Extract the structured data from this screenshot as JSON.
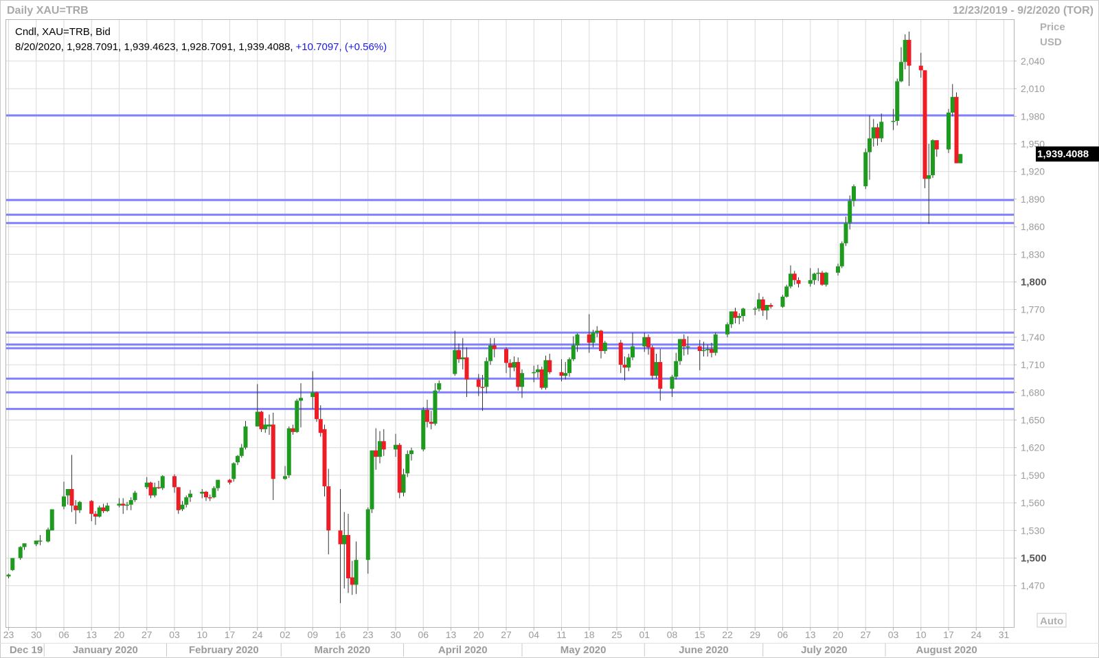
{
  "header": {
    "left_title": "Daily XAU=TRB",
    "right_range": "12/23/2019 - 9/2/2020 (TOR)"
  },
  "info": {
    "line1": "Cndl, XAU=TRB, Bid",
    "line2_values": "8/20/2020, 1,928.7091, 1,939.4623, 1,928.7091, 1,939.4088,",
    "line2_change": "+10.7097, (+0.56%)"
  },
  "price_axis": {
    "header_1": "Price",
    "header_2": "USD",
    "auto_label": "Auto",
    "ticks": [
      "2,040",
      "2,010",
      "1,980",
      "1,950",
      "1,920",
      "1,890",
      "1,860",
      "1,830",
      "1,800",
      "1,770",
      "1,740",
      "1,710",
      "1,680",
      "1,650",
      "1,620",
      "1,590",
      "1,560",
      "1,530",
      "1,500",
      "1,470"
    ],
    "bold_ticks": [
      "1,800",
      "1,500"
    ],
    "last_price_label": "1,939.4088"
  },
  "date_axis": {
    "day_ticks": [
      "23",
      "30",
      "06",
      "13",
      "20",
      "27",
      "03",
      "10",
      "17",
      "24",
      "02",
      "09",
      "16",
      "23",
      "30",
      "06",
      "13",
      "20",
      "27",
      "04",
      "11",
      "18",
      "25",
      "01",
      "08",
      "15",
      "22",
      "29",
      "06",
      "13",
      "20",
      "27",
      "03",
      "10",
      "17",
      "24",
      "31"
    ],
    "month_labels": [
      "Dec 19",
      "January 2020",
      "February 2020",
      "March 2020",
      "April 2020",
      "May 2020",
      "June 2020",
      "July 2020",
      "August 2020"
    ]
  },
  "colors": {
    "up_candle": "#1e9b1e",
    "down_candle": "#ee1c25",
    "level_line": "#8080ff",
    "grid": "#d9d9d9",
    "last_price_bg": "#000000"
  },
  "chart_data": {
    "type": "candlestick",
    "title": "Daily XAU=TRB",
    "symbol": "XAU=TRB",
    "price_type": "Bid",
    "currency": "USD",
    "date_range": "12/23/2019 - 9/2/2020",
    "ylim": [
      1455,
      2066
    ],
    "horizontal_levels": [
      1981,
      1889,
      1873,
      1864,
      1745,
      1732,
      1728,
      1695,
      1680,
      1662
    ],
    "ohlc_columns": [
      "date",
      "open",
      "high",
      "low",
      "close"
    ],
    "ohlc": [
      [
        "2019-12-23",
        1480,
        1483,
        1478,
        1482
      ],
      [
        "2019-12-24",
        1487,
        1500,
        1486,
        1500
      ],
      [
        "2019-12-26",
        1500,
        1513,
        1498,
        1512
      ],
      [
        "2019-12-27",
        1512,
        1516,
        1509,
        1516
      ],
      [
        "2019-12-30",
        1515,
        1519,
        1513,
        1519
      ],
      [
        "2019-12-31",
        1519,
        1525,
        1514,
        1519
      ],
      [
        "2020-01-02",
        1518,
        1533,
        1517,
        1531
      ],
      [
        "2020-01-03",
        1530,
        1553,
        1530,
        1553
      ],
      [
        "2020-01-06",
        1556,
        1583,
        1553,
        1567
      ],
      [
        "2020-01-07",
        1568,
        1575,
        1558,
        1575
      ],
      [
        "2020-01-08",
        1575,
        1612,
        1550,
        1557
      ],
      [
        "2020-01-09",
        1557,
        1563,
        1537,
        1552
      ],
      [
        "2020-01-10",
        1552,
        1562,
        1549,
        1561
      ],
      [
        "2020-01-13",
        1562,
        1563,
        1540,
        1548
      ],
      [
        "2020-01-14",
        1548,
        1551,
        1536,
        1545
      ],
      [
        "2020-01-15",
        1545,
        1557,
        1544,
        1555
      ],
      [
        "2020-01-16",
        1555,
        1559,
        1549,
        1551
      ],
      [
        "2020-01-17",
        1551,
        1560,
        1550,
        1557
      ],
      [
        "2020-01-20",
        1557,
        1565,
        1555,
        1559
      ],
      [
        "2020-01-21",
        1559,
        1565,
        1548,
        1557
      ],
      [
        "2020-01-22",
        1557,
        1561,
        1552,
        1558
      ],
      [
        "2020-01-23",
        1558,
        1566,
        1552,
        1563
      ],
      [
        "2020-01-24",
        1563,
        1573,
        1561,
        1571
      ],
      [
        "2020-01-27",
        1577,
        1588,
        1575,
        1582
      ],
      [
        "2020-01-28",
        1582,
        1583,
        1565,
        1568
      ],
      [
        "2020-01-29",
        1568,
        1582,
        1566,
        1577
      ],
      [
        "2020-01-30",
        1577,
        1584,
        1575,
        1576
      ],
      [
        "2020-01-31",
        1576,
        1590,
        1574,
        1589
      ],
      [
        "2020-02-03",
        1589,
        1591,
        1571,
        1577
      ],
      [
        "2020-02-04",
        1577,
        1577,
        1548,
        1552
      ],
      [
        "2020-02-05",
        1553,
        1562,
        1551,
        1558
      ],
      [
        "2020-02-06",
        1558,
        1568,
        1555,
        1566
      ],
      [
        "2020-02-07",
        1566,
        1574,
        1561,
        1570
      ],
      [
        "2020-02-10",
        1570,
        1575,
        1565,
        1572
      ],
      [
        "2020-02-11",
        1572,
        1573,
        1562,
        1566
      ],
      [
        "2020-02-12",
        1566,
        1569,
        1562,
        1565
      ],
      [
        "2020-02-13",
        1566,
        1578,
        1565,
        1576
      ],
      [
        "2020-02-14",
        1576,
        1585,
        1573,
        1585
      ],
      [
        "2020-02-17",
        1585,
        1586,
        1580,
        1582
      ],
      [
        "2020-02-18",
        1586,
        1604,
        1583,
        1603
      ],
      [
        "2020-02-19",
        1604,
        1612,
        1601,
        1611
      ],
      [
        "2020-02-20",
        1611,
        1624,
        1609,
        1620
      ],
      [
        "2020-02-21",
        1620,
        1649,
        1618,
        1643
      ],
      [
        "2020-02-24",
        1643,
        1689,
        1643,
        1659
      ],
      [
        "2020-02-25",
        1659,
        1660,
        1637,
        1640
      ],
      [
        "2020-02-26",
        1640,
        1652,
        1636,
        1645
      ],
      [
        "2020-02-27",
        1643,
        1656,
        1634,
        1645
      ],
      [
        "2020-02-28",
        1645,
        1658,
        1563,
        1586
      ],
      [
        "2020-03-02",
        1586,
        1600,
        1585,
        1589
      ],
      [
        "2020-03-03",
        1590,
        1643,
        1587,
        1641
      ],
      [
        "2020-03-04",
        1641,
        1645,
        1634,
        1637
      ],
      [
        "2020-03-05",
        1637,
        1673,
        1636,
        1671
      ],
      [
        "2020-03-06",
        1671,
        1690,
        1642,
        1674
      ],
      [
        "2020-03-09",
        1675,
        1703,
        1662,
        1680
      ],
      [
        "2020-03-10",
        1680,
        1681,
        1648,
        1651
      ],
      [
        "2020-03-11",
        1651,
        1666,
        1632,
        1636
      ],
      [
        "2020-03-12",
        1640,
        1645,
        1567,
        1578
      ],
      [
        "2020-03-13",
        1578,
        1597,
        1504,
        1530
      ],
      [
        "2020-03-16",
        1530,
        1575,
        1451,
        1515
      ],
      [
        "2020-03-17",
        1515,
        1550,
        1467,
        1525
      ],
      [
        "2020-03-18",
        1525,
        1548,
        1462,
        1478
      ],
      [
        "2020-03-19",
        1479,
        1497,
        1460,
        1471
      ],
      [
        "2020-03-20",
        1471,
        1518,
        1461,
        1498
      ],
      [
        "2020-03-23",
        1498,
        1555,
        1483,
        1553
      ],
      [
        "2020-03-24",
        1553,
        1617,
        1549,
        1617
      ],
      [
        "2020-03-25",
        1617,
        1641,
        1596,
        1610
      ],
      [
        "2020-03-26",
        1610,
        1638,
        1603,
        1627
      ],
      [
        "2020-03-27",
        1627,
        1640,
        1611,
        1618
      ],
      [
        "2020-03-30",
        1618,
        1635,
        1610,
        1623
      ],
      [
        "2020-03-31",
        1623,
        1625,
        1565,
        1571
      ],
      [
        "2020-04-01",
        1571,
        1597,
        1567,
        1591
      ],
      [
        "2020-04-02",
        1592,
        1617,
        1588,
        1613
      ],
      [
        "2020-04-03",
        1613,
        1620,
        1606,
        1617
      ],
      [
        "2020-04-06",
        1618,
        1664,
        1616,
        1661
      ],
      [
        "2020-04-07",
        1661,
        1672,
        1642,
        1648
      ],
      [
        "2020-04-08",
        1648,
        1660,
        1640,
        1646
      ],
      [
        "2020-04-09",
        1646,
        1690,
        1644,
        1682
      ],
      [
        "2020-04-10",
        1683,
        1693,
        1681,
        1690
      ],
      [
        "2020-04-14",
        1700,
        1747,
        1698,
        1726
      ],
      [
        "2020-04-15",
        1726,
        1733,
        1712,
        1716
      ],
      [
        "2020-04-16",
        1716,
        1739,
        1705,
        1718
      ],
      [
        "2020-04-17",
        1718,
        1729,
        1675,
        1694
      ],
      [
        "2020-04-20",
        1694,
        1700,
        1676,
        1686
      ],
      [
        "2020-04-21",
        1686,
        1699,
        1660,
        1685
      ],
      [
        "2020-04-22",
        1686,
        1718,
        1679,
        1714
      ],
      [
        "2020-04-23",
        1714,
        1739,
        1710,
        1731
      ],
      [
        "2020-04-24",
        1731,
        1739,
        1718,
        1727
      ],
      [
        "2020-04-27",
        1727,
        1729,
        1701,
        1712
      ],
      [
        "2020-04-28",
        1712,
        1716,
        1696,
        1707
      ],
      [
        "2020-04-29",
        1707,
        1719,
        1703,
        1713
      ],
      [
        "2020-04-30",
        1713,
        1718,
        1682,
        1686
      ],
      [
        "2020-05-01",
        1686,
        1705,
        1674,
        1701
      ],
      [
        "2020-05-04",
        1701,
        1709,
        1691,
        1702
      ],
      [
        "2020-05-05",
        1702,
        1710,
        1696,
        1705
      ],
      [
        "2020-05-06",
        1705,
        1708,
        1683,
        1685
      ],
      [
        "2020-05-07",
        1685,
        1720,
        1683,
        1715
      ],
      [
        "2020-05-08",
        1715,
        1722,
        1700,
        1702
      ],
      [
        "2020-05-11",
        1702,
        1716,
        1692,
        1698
      ],
      [
        "2020-05-12",
        1698,
        1713,
        1694,
        1701
      ],
      [
        "2020-05-13",
        1701,
        1718,
        1697,
        1716
      ],
      [
        "2020-05-14",
        1716,
        1741,
        1714,
        1731
      ],
      [
        "2020-05-15",
        1731,
        1744,
        1724,
        1743
      ],
      [
        "2020-05-18",
        1743,
        1765,
        1723,
        1734
      ],
      [
        "2020-05-19",
        1734,
        1748,
        1729,
        1745
      ],
      [
        "2020-05-20",
        1745,
        1752,
        1740,
        1747
      ],
      [
        "2020-05-21",
        1747,
        1748,
        1717,
        1725
      ],
      [
        "2020-05-22",
        1725,
        1736,
        1722,
        1734
      ],
      [
        "2020-05-26",
        1734,
        1737,
        1701,
        1710
      ],
      [
        "2020-05-27",
        1710,
        1719,
        1693,
        1707
      ],
      [
        "2020-05-28",
        1707,
        1722,
        1703,
        1718
      ],
      [
        "2020-05-29",
        1718,
        1745,
        1715,
        1730
      ],
      [
        "2020-06-01",
        1730,
        1745,
        1724,
        1740
      ],
      [
        "2020-06-02",
        1740,
        1743,
        1721,
        1729
      ],
      [
        "2020-06-03",
        1729,
        1731,
        1694,
        1698
      ],
      [
        "2020-06-04",
        1698,
        1722,
        1695,
        1713
      ],
      [
        "2020-06-05",
        1713,
        1727,
        1671,
        1684
      ],
      [
        "2020-06-08",
        1684,
        1699,
        1675,
        1697
      ],
      [
        "2020-06-09",
        1697,
        1723,
        1694,
        1714
      ],
      [
        "2020-06-10",
        1714,
        1738,
        1710,
        1738
      ],
      [
        "2020-06-11",
        1738,
        1743,
        1720,
        1730
      ],
      [
        "2020-06-12",
        1730,
        1741,
        1721,
        1730
      ],
      [
        "2020-06-15",
        1730,
        1737,
        1704,
        1725
      ],
      [
        "2020-06-16",
        1725,
        1735,
        1719,
        1726
      ],
      [
        "2020-06-17",
        1726,
        1732,
        1719,
        1727
      ],
      [
        "2020-06-18",
        1727,
        1734,
        1718,
        1723
      ],
      [
        "2020-06-19",
        1723,
        1745,
        1720,
        1743
      ],
      [
        "2020-06-22",
        1743,
        1756,
        1740,
        1754
      ],
      [
        "2020-06-23",
        1754,
        1768,
        1750,
        1768
      ],
      [
        "2020-06-24",
        1768,
        1772,
        1755,
        1761
      ],
      [
        "2020-06-25",
        1761,
        1766,
        1754,
        1763
      ],
      [
        "2020-06-26",
        1763,
        1772,
        1757,
        1771
      ],
      [
        "2020-06-29",
        1771,
        1773,
        1764,
        1771
      ],
      [
        "2020-06-30",
        1771,
        1788,
        1768,
        1781
      ],
      [
        "2020-07-01",
        1781,
        1784,
        1763,
        1769
      ],
      [
        "2020-07-02",
        1769,
        1775,
        1759,
        1775
      ],
      [
        "2020-07-03",
        1775,
        1777,
        1771,
        1773
      ],
      [
        "2020-07-06",
        1773,
        1786,
        1772,
        1784
      ],
      [
        "2020-07-07",
        1784,
        1797,
        1783,
        1795
      ],
      [
        "2020-07-08",
        1795,
        1818,
        1793,
        1809
      ],
      [
        "2020-07-09",
        1809,
        1812,
        1797,
        1802
      ],
      [
        "2020-07-10",
        1802,
        1805,
        1794,
        1798
      ],
      [
        "2020-07-13",
        1798,
        1815,
        1795,
        1802
      ],
      [
        "2020-07-14",
        1802,
        1810,
        1797,
        1809
      ],
      [
        "2020-07-15",
        1809,
        1815,
        1801,
        1810
      ],
      [
        "2020-07-16",
        1810,
        1812,
        1796,
        1797
      ],
      [
        "2020-07-17",
        1797,
        1811,
        1795,
        1810
      ],
      [
        "2020-07-20",
        1810,
        1820,
        1807,
        1817
      ],
      [
        "2020-07-21",
        1817,
        1844,
        1815,
        1842
      ],
      [
        "2020-07-22",
        1842,
        1871,
        1839,
        1864
      ],
      [
        "2020-07-23",
        1864,
        1894,
        1857,
        1888
      ],
      [
        "2020-07-24",
        1888,
        1906,
        1882,
        1904
      ],
      [
        "2020-07-27",
        1904,
        1945,
        1901,
        1941
      ],
      [
        "2020-07-28",
        1941,
        1981,
        1911,
        1956
      ],
      [
        "2020-07-29",
        1956,
        1977,
        1947,
        1968
      ],
      [
        "2020-07-30",
        1968,
        1972,
        1948,
        1956
      ],
      [
        "2020-07-31",
        1956,
        1983,
        1952,
        1974
      ],
      [
        "2020-08-03",
        1974,
        1988,
        1965,
        1975
      ],
      [
        "2020-08-04",
        1975,
        2021,
        1970,
        2018
      ],
      [
        "2020-08-05",
        2018,
        2055,
        2017,
        2039
      ],
      [
        "2020-08-06",
        2039,
        2069,
        2031,
        2063
      ],
      [
        "2020-08-07",
        2063,
        2072,
        2013,
        2035
      ],
      [
        "2020-08-10",
        2035,
        2049,
        2022,
        2030
      ],
      [
        "2020-08-11",
        2030,
        2030,
        1902,
        1912
      ],
      [
        "2020-08-12",
        1912,
        1950,
        1863,
        1916
      ],
      [
        "2020-08-13",
        1916,
        1955,
        1913,
        1954
      ],
      [
        "2020-08-14",
        1954,
        1954,
        1936,
        1944
      ],
      [
        "2020-08-17",
        1944,
        1988,
        1940,
        1984
      ],
      [
        "2020-08-18",
        1984,
        2015,
        1980,
        2001
      ],
      [
        "2020-08-19",
        2001,
        2006,
        1929,
        1929
      ],
      [
        "2020-08-20",
        1929,
        1939,
        1929,
        1939
      ]
    ]
  }
}
